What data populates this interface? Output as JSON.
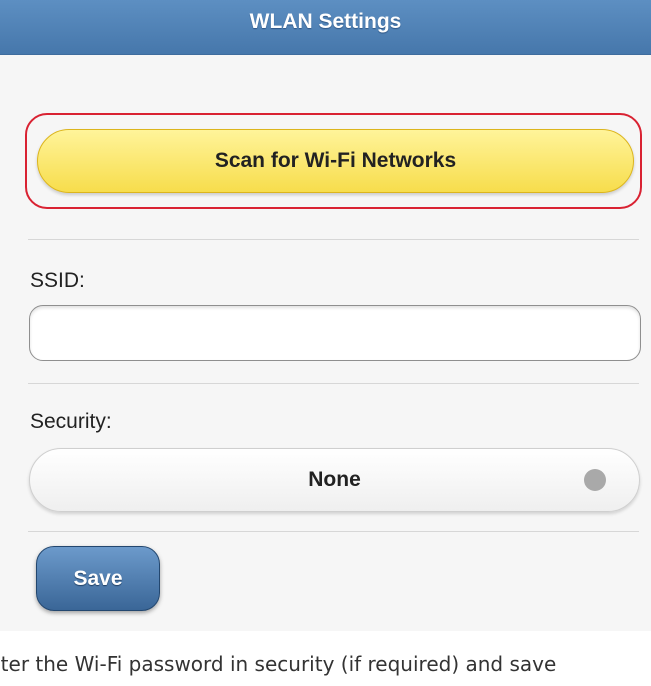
{
  "header": {
    "title": "WLAN Settings"
  },
  "scan_button": {
    "label": "Scan for Wi-Fi Networks",
    "highlight_color": "#d92232"
  },
  "ssid": {
    "label": "SSID:",
    "value": ""
  },
  "security": {
    "label": "Security:",
    "selected_value": "None",
    "indicator": "radio-dot-icon"
  },
  "save_button": {
    "label": "Save"
  },
  "caption": {
    "text": "nter the Wi-Fi password in security (if required) and save"
  },
  "colors": {
    "header_blue": "#4677ab",
    "scan_yellow": "#f7dd4c",
    "save_blue": "#3a6697"
  }
}
